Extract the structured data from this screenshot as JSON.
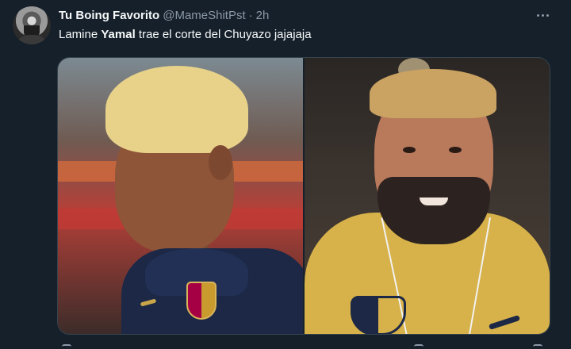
{
  "tweet": {
    "display_name": "Tu Boing Favorito",
    "handle": "@MameShitPst",
    "separator": "·",
    "time": "2h",
    "text_before": "Lamine ",
    "text_bold": "Yamal",
    "text_after": " trae el corte del Chuyazo jajajaja",
    "more_icon": "more-horizontal-icon"
  },
  "media": {
    "images": [
      {
        "name": "left-photo",
        "subject": "player"
      },
      {
        "name": "right-photo",
        "subject": "man"
      }
    ]
  },
  "colors": {
    "background": "#15202b",
    "text_primary": "#f7f9f9",
    "text_secondary": "#8b98a5",
    "border": "#38444d"
  }
}
